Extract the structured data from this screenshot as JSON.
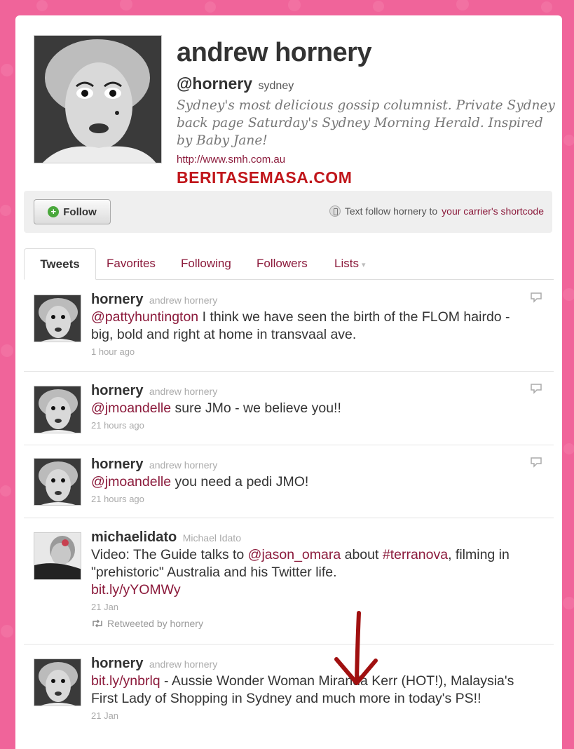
{
  "profile": {
    "name": "andrew hornery",
    "handle": "@hornery",
    "location": "sydney",
    "bio": "Sydney's most delicious gossip columnist. Private Sydney back page Saturday's Sydney Morning Herald. Inspired by Baby Jane!",
    "url": "http://www.smh.com.au",
    "watermark": "BERITASEMASA.COM"
  },
  "actions": {
    "follow_label": "Follow",
    "text_follow_prefix": "Text follow hornery to",
    "carrier_link": "your carrier's shortcode"
  },
  "tabs": [
    {
      "label": "Tweets",
      "active": true
    },
    {
      "label": "Favorites"
    },
    {
      "label": "Following"
    },
    {
      "label": "Followers"
    },
    {
      "label": "Lists"
    }
  ],
  "tweets": [
    {
      "username": "hornery",
      "fullname": "andrew hornery",
      "mention": "@pattyhuntington",
      "text": " I think we have seen the birth of the FLOM hairdo - big, bold and right at home in transvaal ave.",
      "time": "1 hour ago"
    },
    {
      "username": "hornery",
      "fullname": "andrew hornery",
      "mention": "@jmoandelle",
      "text": " sure JMo - we believe you!!",
      "time": "21 hours ago"
    },
    {
      "username": "hornery",
      "fullname": "andrew hornery",
      "mention": "@jmoandelle",
      "text": " you need a pedi JMO!",
      "time": "21 hours ago"
    },
    {
      "username": "michaelidato",
      "fullname": "Michael Idato",
      "text_a": "Video: The Guide talks to ",
      "mention": "@jason_omara",
      "text_b": " about ",
      "hashtag": "#terranova",
      "text_c": ", filming in \"prehistoric\" Australia and his Twitter life.",
      "link": "bit.ly/yYOMWy",
      "time": "21 Jan",
      "retweet": "Retweeted by hornery"
    },
    {
      "username": "hornery",
      "fullname": "andrew hornery",
      "link": "bit.ly/ynbrlq",
      "text": " - Aussie Wonder Woman Miranda Kerr (HOT!), Malaysia's First Lady of Shopping in Sydney and much more in today's PS!!",
      "time": "21 Jan"
    }
  ],
  "colors": {
    "background": "#f0649a",
    "link": "#8b1a3b",
    "watermark": "#c0161b",
    "annotation_arrow": "#a01010"
  }
}
